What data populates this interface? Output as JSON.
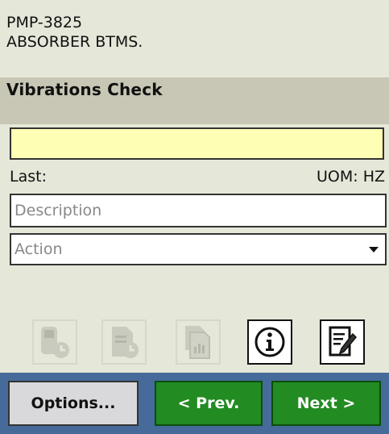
{
  "equipment": {
    "id": "PMP-3825",
    "name": "ABSORBER BTMS."
  },
  "section": {
    "title": "Vibrations Check"
  },
  "reading": {
    "value": ""
  },
  "last": {
    "label": "Last:",
    "uom": "UOM: HZ"
  },
  "description": {
    "placeholder": "Description",
    "value": ""
  },
  "action": {
    "value": "Action"
  },
  "icons": [
    "device-clock-icon",
    "document-clock-icon",
    "documents-chart-icon",
    "info-icon",
    "notepad-edit-icon"
  ],
  "nav": {
    "options_label": "Options...",
    "prev_label": "< Prev.",
    "next_label": "Next >"
  },
  "colors": {
    "background": "#e5e7d9",
    "section_bar": "#c8c6b4",
    "input_highlight": "#fffeb5",
    "nav_bar": "#466a9a",
    "nav_button_green": "#228b22"
  }
}
